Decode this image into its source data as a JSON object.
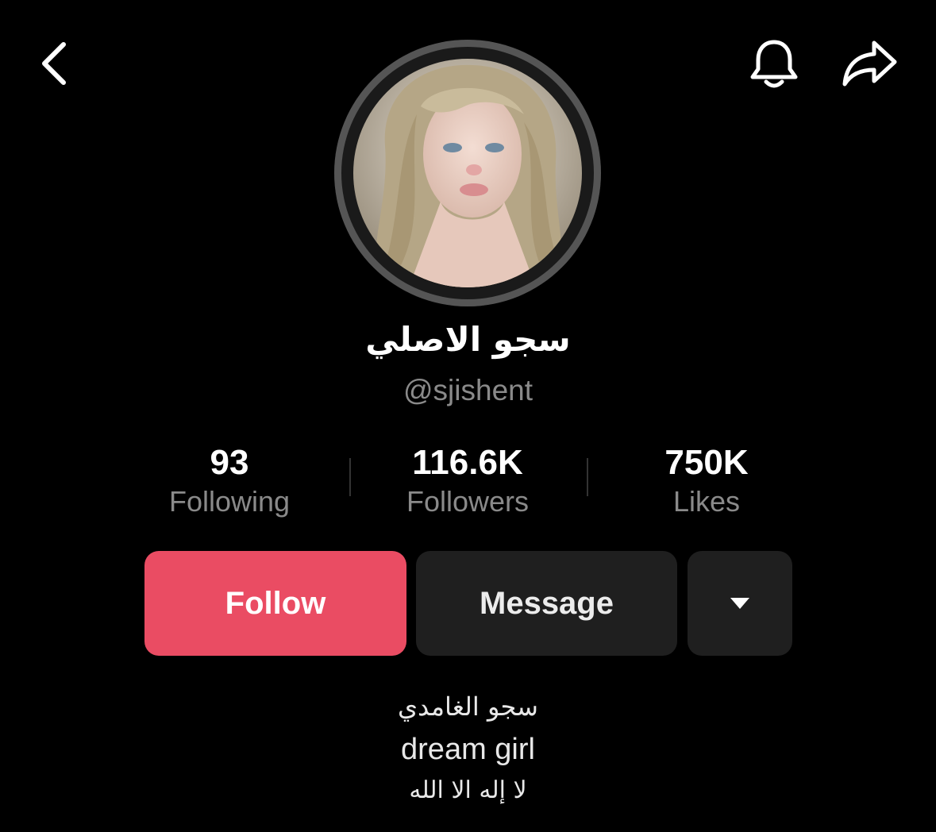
{
  "nav": {
    "back_icon": "chevron-left-icon",
    "bell_icon": "bell-icon",
    "share_icon": "share-arrow-icon"
  },
  "profile": {
    "avatar": "profile-photo",
    "display_name": "سجو الاصلي",
    "handle": "@sjishent"
  },
  "stats": [
    {
      "value": "93",
      "label": "Following"
    },
    {
      "value": "116.6K",
      "label": "Followers"
    },
    {
      "value": "750K",
      "label": "Likes"
    }
  ],
  "actions": {
    "follow_label": "Follow",
    "message_label": "Message",
    "more_icon": "caret-down-icon"
  },
  "bio": [
    "سجو الغامدي",
    "dream girl",
    "لا إله الا الله"
  ],
  "colors": {
    "background": "#000000",
    "follow_button": "#ea4c63",
    "secondary_button": "#1f1f1f",
    "muted_text": "#8a8a8a"
  }
}
